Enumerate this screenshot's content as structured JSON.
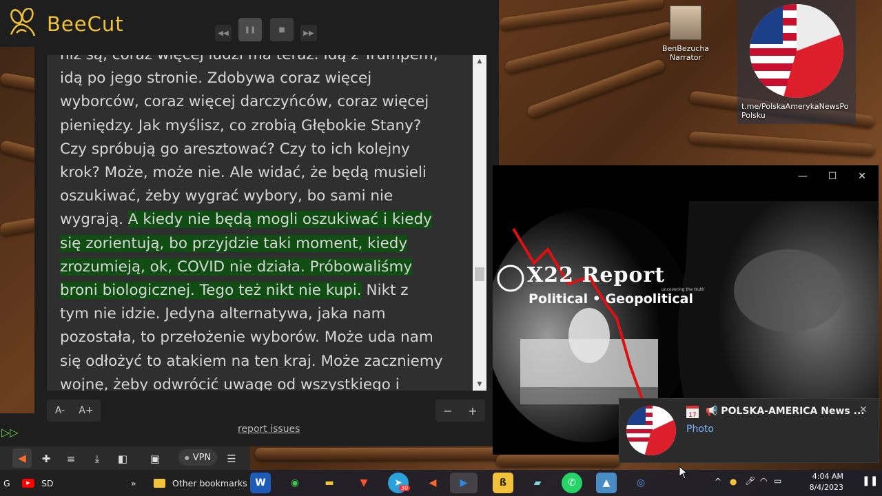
{
  "app": {
    "title": "BeeCut"
  },
  "player": {
    "rewind": "◀◀",
    "pause": "❚❚",
    "stop": "■",
    "forward": "▶▶"
  },
  "reader": {
    "lines": [
      {
        "text": "niż są, coraz więcej ludzi ma teraz. Idą z Trumpem,",
        "highlight": false
      },
      {
        "text": "idą po jego stronie. Zdobywa coraz więcej",
        "highlight": false
      },
      {
        "text": "wyborców, coraz więcej darczyńców, coraz więcej",
        "highlight": false
      },
      {
        "text": "pieniędzy. Jak myślisz, co zrobią Głębokie Stany?",
        "highlight": false
      },
      {
        "text": "Czy spróbują go aresztować? Czy to ich kolejny",
        "highlight": false
      },
      {
        "text": "krok? Może, może nie. Ale widać, że będą musieli",
        "highlight": false
      },
      {
        "text": "oszukiwać, żeby wygrać wybory, bo sami nie",
        "highlight": false
      }
    ],
    "line8_pre": "wygrają. ",
    "line8_hl": "A kiedy nie będą mogli oszukiwać i kiedy",
    "line9_hl": "się zorientują, bo przyjdzie taki moment, kiedy",
    "line10_hl": "zrozumieją, ok, COVID nie działa. Próbowaliśmy",
    "line11_hl": "broni biologicznej. Tego też nikt nie kupi.",
    "line11_post": " Nikt z",
    "rest": [
      "tym nie idzie. Jedyna alternatywa, jaka nam",
      "pozostała, to przełożenie wyborów. Może uda nam",
      "się odłożyć to atakiem na ten kraj. Może zaczniemy",
      "wojnę, żeby odwrócić uwagę od wszystkiego i"
    ]
  },
  "font_controls": {
    "decrease": "A-",
    "increase": "A+"
  },
  "zoom_controls": {
    "minus": "−",
    "plus": "+"
  },
  "report_link": "report issues",
  "browser": {
    "vpn": "VPN",
    "bookmarks": {
      "g": "G",
      "sd": "SD",
      "more": "»",
      "other": "Other bookmarks"
    }
  },
  "desktop": {
    "icon1_line1": "BenBezucha",
    "icon1_line2": "Narrator",
    "icon2_line1": "t.me/PolskaAmerykaNewsPo",
    "icon2_line2": "Polsku"
  },
  "video": {
    "title": "X22 Report",
    "tagline": "uncovering the truth",
    "subtitle": "Political • Geopolitical",
    "minimize": "—",
    "maximize": "☐",
    "close": "✕"
  },
  "notification": {
    "title": "📢 POLSKA-AMERICA News ...",
    "subtitle": "Photo",
    "date_icon": "17",
    "close": "✕"
  },
  "clock": {
    "time": "4:04 AM",
    "date": "8/4/2023"
  },
  "taskbar": {
    "badge": "30"
  }
}
